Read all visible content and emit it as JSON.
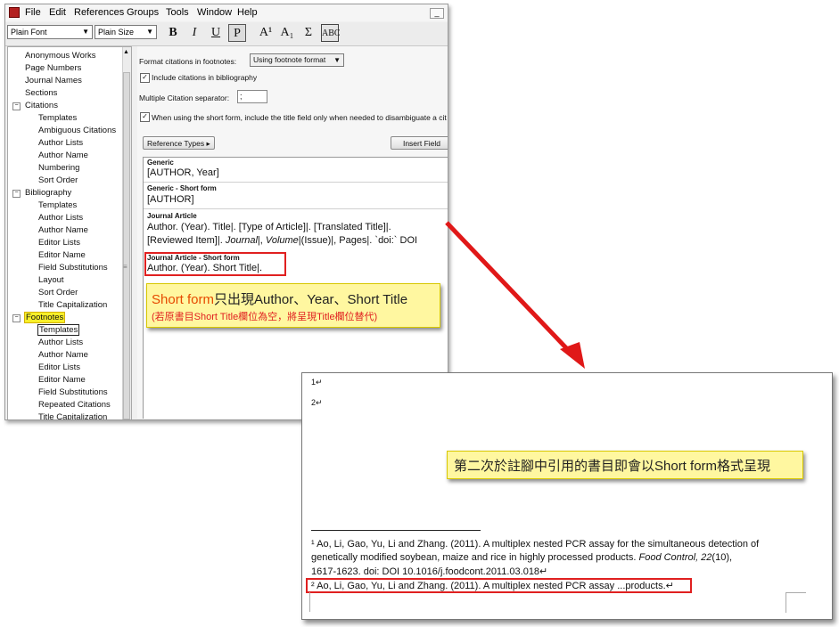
{
  "app": {
    "menu": [
      "File",
      "Edit",
      "References",
      "Groups",
      "Tools",
      "Window",
      "Help"
    ],
    "toolbar": {
      "font_select": "Plain Font",
      "size_select": "Plain Size",
      "buttons": [
        "B",
        "I",
        "U",
        "P",
        "A¹",
        "A₁",
        "Σ",
        "ABC"
      ]
    }
  },
  "tree": {
    "items": [
      {
        "label": "Anonymous Works",
        "level": 1
      },
      {
        "label": "Page Numbers",
        "level": 1
      },
      {
        "label": "Journal Names",
        "level": 1
      },
      {
        "label": "Sections",
        "level": 1
      },
      {
        "label": "Citations",
        "level": 0,
        "expander": "−"
      },
      {
        "label": "Templates",
        "level": 2
      },
      {
        "label": "Ambiguous Citations",
        "level": 2
      },
      {
        "label": "Author Lists",
        "level": 2
      },
      {
        "label": "Author Name",
        "level": 2
      },
      {
        "label": "Numbering",
        "level": 2
      },
      {
        "label": "Sort Order",
        "level": 2
      },
      {
        "label": "Bibliography",
        "level": 0,
        "expander": "−"
      },
      {
        "label": "Templates",
        "level": 2
      },
      {
        "label": "Author Lists",
        "level": 2
      },
      {
        "label": "Author Name",
        "level": 2
      },
      {
        "label": "Editor Lists",
        "level": 2
      },
      {
        "label": "Editor Name",
        "level": 2
      },
      {
        "label": "Field Substitutions",
        "level": 2
      },
      {
        "label": "Layout",
        "level": 2
      },
      {
        "label": "Sort Order",
        "level": 2
      },
      {
        "label": "Title Capitalization",
        "level": 2
      },
      {
        "label": "Footnotes",
        "level": 0,
        "expander": "−",
        "highlight": true
      },
      {
        "label": "Templates",
        "level": 2,
        "selected": true
      },
      {
        "label": "Author Lists",
        "level": 2
      },
      {
        "label": "Author Name",
        "level": 2
      },
      {
        "label": "Editor Lists",
        "level": 2
      },
      {
        "label": "Editor Name",
        "level": 2
      },
      {
        "label": "Field Substitutions",
        "level": 2
      },
      {
        "label": "Repeated Citations",
        "level": 2
      },
      {
        "label": "Title Capitalization",
        "level": 2
      }
    ]
  },
  "settings": {
    "format_label": "Format citations in footnotes:",
    "format_value": "Using footnote format",
    "include_label": "Include citations in bibliography",
    "separator_label": "Multiple Citation separator:",
    "separator_value": ";",
    "shortform_label": "When using the short form, include the title field only when needed to disambiguate a cit",
    "ref_types_button": "Reference Types",
    "insert_field_button": "Insert Field"
  },
  "editor": {
    "generic_h": "Generic",
    "generic_b": "[AUTHOR, Year]",
    "generic_short_h": "Generic - Short form",
    "generic_short_b": "[AUTHOR]",
    "journal_h": "Journal Article",
    "journal_b1": "Author. (Year). Title|. [Type of Article]|. [Translated Title]|.",
    "journal_b2_a": "[Reviewed Item]|. ",
    "journal_b2_b": "Journal",
    "journal_b2_c": "|, ",
    "journal_b2_d": "Volume",
    "journal_b2_e": "|(Issue)|, Pages|. `doi:` DOI",
    "journal_short_h": "Journal Article - Short form",
    "journal_short_b": "Author. (Year). Short Title|."
  },
  "note1": {
    "line1_red": "Short form",
    "line1_rest": "只出現Author、Year、Short Title",
    "line2": "(若原書目Short Title欄位為空，將呈現Title欄位替代)"
  },
  "note2": {
    "text": "第二次於註腳中引用的書目即會以Short form格式呈現"
  },
  "doc": {
    "ref1_marker": "1↵",
    "ref2_marker": "2↵",
    "footnote1_l1": "¹  Ao, Li, Gao, Yu, Li and Zhang. (2011). A multiplex nested PCR assay for the simultaneous detection of",
    "footnote1_l2_a": "genetically modified soybean, maize and rice in highly processed products. ",
    "footnote1_l2_b": "Food Control, 22",
    "footnote1_l2_c": "(10),",
    "footnote1_l3": "1617-1623. doi: DOI 10.1016/j.foodcont.2011.03.018↵",
    "footnote2": "²  Ao, Li, Gao, Yu, Li and Zhang. (2011). A multiplex nested PCR assay ...products.↵"
  }
}
